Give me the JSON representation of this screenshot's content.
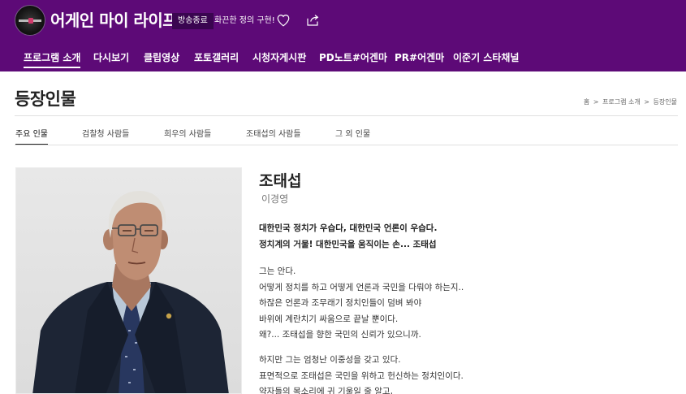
{
  "header": {
    "program_title": "어게인 마이 라이프",
    "badge": "방송종료",
    "tagline": "화끈한 정의 구현!",
    "colors": {
      "background": "#5d0a77",
      "badge_bg": "#3a0550",
      "text": "#ffffff"
    },
    "icons": {
      "logo": "program-logo-icon",
      "like": "heart-icon",
      "share": "share-icon"
    }
  },
  "gnb": {
    "items": [
      {
        "label": "프로그램 소개",
        "active": true
      },
      {
        "label": "다시보기",
        "active": false
      },
      {
        "label": "클립영상",
        "active": false
      },
      {
        "label": "포토갤러리",
        "active": false
      },
      {
        "label": "시청자게시판",
        "active": false
      },
      {
        "label": "PD노트#어겐마",
        "active": false
      },
      {
        "label": "PR#어겐마",
        "active": false
      },
      {
        "label": "이준기 스타채널",
        "active": false
      }
    ]
  },
  "page": {
    "title": "등장인물",
    "breadcrumb": [
      "홈",
      "프로그램 소개",
      "등장인물"
    ],
    "breadcrumb_separator": ">"
  },
  "subtabs": {
    "items": [
      {
        "label": "주요 인물",
        "active": true
      },
      {
        "label": "검찰청 사람들",
        "active": false
      },
      {
        "label": "희우의 사람들",
        "active": false
      },
      {
        "label": "조태섭의 사람들",
        "active": false
      },
      {
        "label": "그 외 인물",
        "active": false
      }
    ]
  },
  "character": {
    "name": "조태섭",
    "actor": "이경영",
    "headline": [
      "대한민국 정치가 우습다, 대한민국 언론이 우습다.",
      "정치계의 거물! 대한민국을 움직이는 손... 조태섭"
    ],
    "paragraph1": [
      "그는 안다.",
      "어떻게 정치를 하고 어떻게 언론과 국민을 다뤄야 하는지..",
      "하잖은 언론과 조무래기 정치인들이 덤벼 봐야",
      "바위에 계란치기 싸움으로 끝날 뿐이다.",
      "왜?... 조태섭을 향한 국민의 신뢰가 있으니까."
    ],
    "paragraph2": [
      "하지만 그는 엄청난 이중성을 갖고 있다.",
      "표면적으로 조태섭은 국민을 위하고 헌신하는 정치인이다.",
      "약자들의 목소리에 귀 기울일 줄 알고,"
    ]
  }
}
